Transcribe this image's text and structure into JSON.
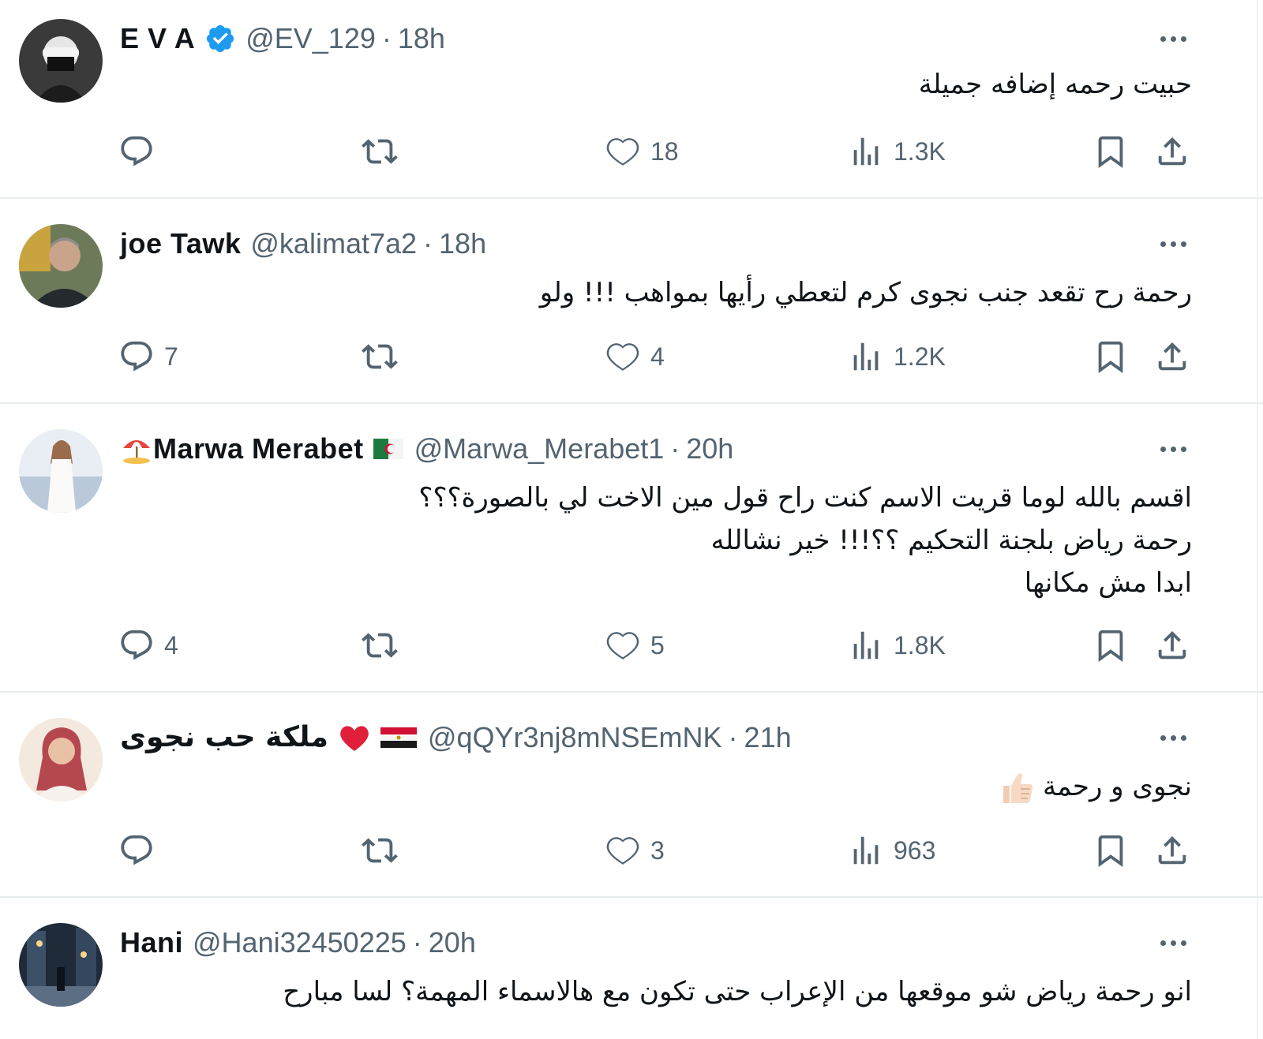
{
  "tweets": [
    {
      "display_name": "E V A",
      "verified": true,
      "handle": "@EV_129",
      "time": "18h",
      "text_lines": [
        "حبيت رحمه إضافه جميلة"
      ],
      "stats": {
        "replies": "",
        "likes": "18",
        "views": "1.3K"
      },
      "avatar_colors": [
        "#2a2a2a",
        "#e8e8e8"
      ]
    },
    {
      "display_name": "joe Tawk",
      "handle": "@kalimat7a2",
      "time": "18h",
      "text_lines": [
        "رحمة رح تقعد جنب نجوى كرم لتعطي رأيها بمواهب !!! ولو"
      ],
      "stats": {
        "replies": "7",
        "likes": "4",
        "views": "1.2K"
      },
      "avatar_colors": [
        "#3b3f3a",
        "#b9b4a8"
      ]
    },
    {
      "display_name": "Marwa Merabet",
      "name_prefix_icon": "beach-umbrella-icon",
      "name_suffix_icon": "algeria-flag-icon",
      "handle": "@Marwa_Merabet1",
      "time": "20h",
      "text_lines": [
        "اقسم بالله لوما قريت الاسم كنت راح قول مين الاخت لي بالصورة؟؟؟",
        "رحمة رياض بلجنة التحكيم ؟؟!!! خير نشالله",
        "ابدا مش مكانها"
      ],
      "stats": {
        "replies": "4",
        "likes": "5",
        "views": "1.8K"
      },
      "avatar_colors": [
        "#cfd9e6",
        "#f4f1ee"
      ]
    },
    {
      "display_name": "ملكة حب نجوى",
      "name_suffix_icons": [
        "red-heart-icon",
        "egypt-flag-icon"
      ],
      "handle": "@qQYr3nj8mNSEmNK",
      "time": "21h",
      "text_lines": [
        "نجوى و رحمة"
      ],
      "text_suffix_icon": "thumbs-up-icon",
      "stats": {
        "replies": "",
        "likes": "3",
        "views": "963"
      },
      "avatar_colors": [
        "#f1e3d6",
        "#b8444d"
      ]
    },
    {
      "display_name": "Hani",
      "handle": "@Hani32450225",
      "time": "20h",
      "text_lines": [
        "انو رحمة رياض شو موقعها من الإعراب حتى تكون مع هالاسماء المهمة؟ لسا مبارح"
      ],
      "avatar_colors": [
        "#1e2a38",
        "#6c7f95"
      ]
    }
  ],
  "colors": {
    "text_primary": "#0f1419",
    "text_secondary": "#536471",
    "verified_blue": "#1d9bf0",
    "divider": "#e8ecef"
  },
  "icons": {
    "reply": "speech-bubble-icon",
    "retweet": "retweet-arrows-icon",
    "like": "heart-outline-icon",
    "views": "bar-chart-icon",
    "bookmark": "bookmark-icon",
    "share": "share-upload-icon",
    "more": "three-dots-icon"
  }
}
